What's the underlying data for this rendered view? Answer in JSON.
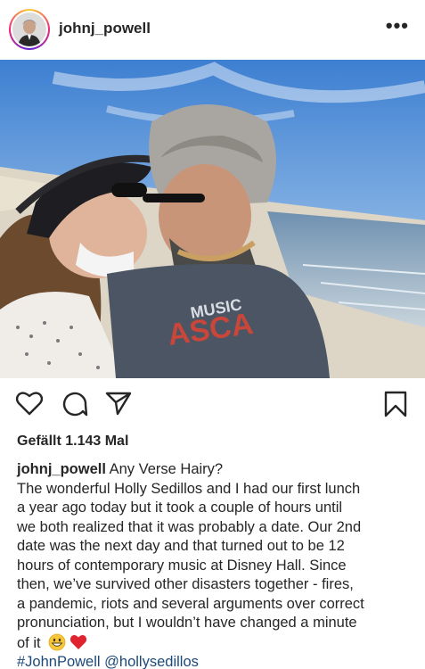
{
  "post": {
    "username": "johnj_powell",
    "more_icon": "more-horizontal-icon",
    "likes_text": "Gefällt 1.143 Mal",
    "caption": {
      "author": "johnj_powell",
      "title": "Any Verse Hairy?",
      "lines": [
        "The wonderful Holly Sedillos and I had our first lunch",
        "a year ago today but it took a couple of hours until",
        "we both realized that it was probably a date. Our 2nd",
        "date was the next day and that turned out to be 12",
        "hours of contemporary music at Disney Hall. Since",
        "then, we’ve survived other disasters together - fires,",
        "a pandemic, riots and several arguments over correct",
        "pronunciation, but I wouldn’t have changed a minute"
      ],
      "last_line": "of it",
      "emojis": [
        "grinning-face-emoji",
        "red-heart-emoji"
      ],
      "hashtag": "#JohnPowell",
      "mention": "@hollysedillos"
    },
    "actions": {
      "like_icon": "heart-icon",
      "comment_icon": "comment-icon",
      "share_icon": "send-icon",
      "save_icon": "bookmark-icon"
    },
    "photo_text": {
      "shirt": "MUSIC"
    },
    "colors": {
      "text": "#262626",
      "link": "#1c4a7a",
      "sky": "#4f8fd6",
      "sand": "#ddd5c6",
      "water": "#7c9db8"
    }
  }
}
